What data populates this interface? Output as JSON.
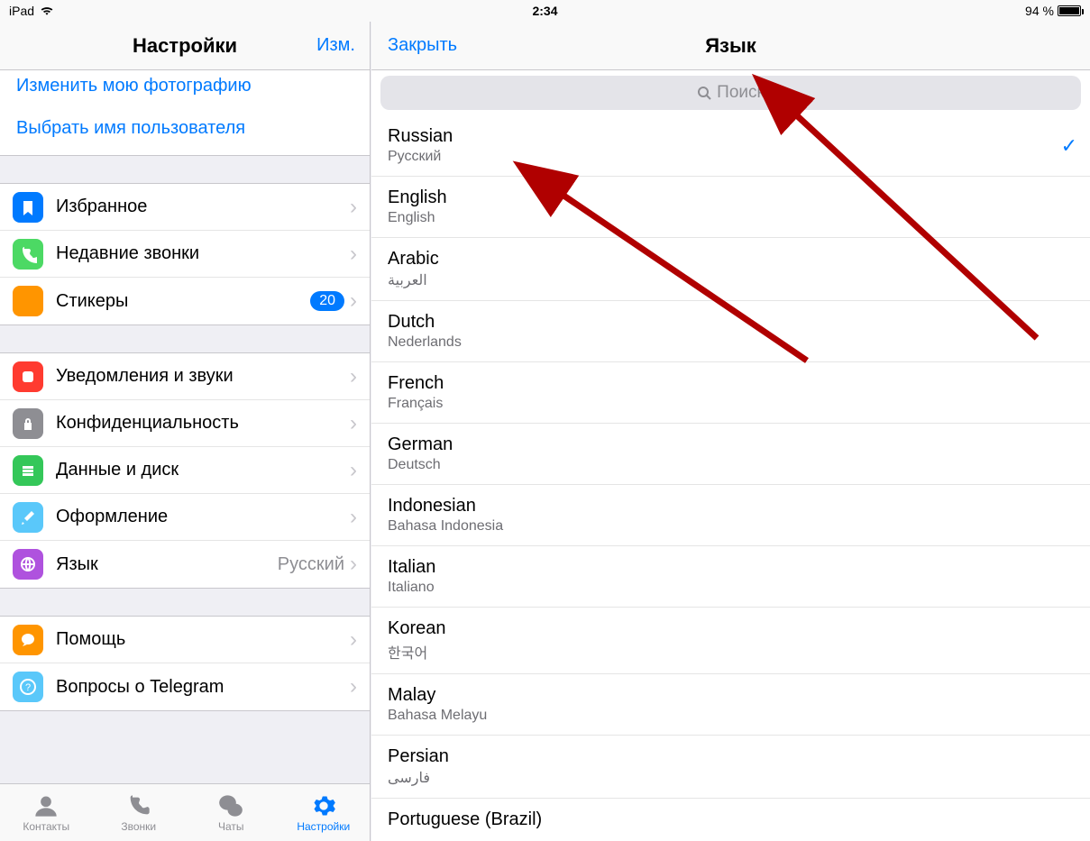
{
  "status": {
    "device": "iPad",
    "time": "2:34",
    "battery_text": "94 %"
  },
  "left": {
    "title": "Настройки",
    "edit": "Изм.",
    "profile_links": {
      "change_photo": "Изменить мою фотографию",
      "choose_username": "Выбрать имя пользователя"
    },
    "group1": [
      {
        "id": "saved",
        "label": "Избранное",
        "icon": "bookmark",
        "bg": "bg-blue"
      },
      {
        "id": "recent",
        "label": "Недавние звонки",
        "icon": "phone",
        "bg": "bg-green"
      },
      {
        "id": "stickers",
        "label": "Стикеры",
        "icon": "moon",
        "bg": "bg-orange",
        "badge": "20"
      }
    ],
    "group2": [
      {
        "id": "notif",
        "label": "Уведомления и звуки",
        "icon": "app",
        "bg": "bg-red"
      },
      {
        "id": "privacy",
        "label": "Конфиденциальность",
        "icon": "lock",
        "bg": "bg-gray"
      },
      {
        "id": "data",
        "label": "Данные и диск",
        "icon": "stack",
        "bg": "bg-teal"
      },
      {
        "id": "appearance",
        "label": "Оформление",
        "icon": "brush",
        "bg": "bg-skyblue"
      },
      {
        "id": "language",
        "label": "Язык",
        "icon": "globe",
        "bg": "bg-purple",
        "detail": "Русский"
      }
    ],
    "group3": [
      {
        "id": "help",
        "label": "Помощь",
        "icon": "chat",
        "bg": "bg-orange"
      },
      {
        "id": "faq",
        "label": "Вопросы о Telegram",
        "icon": "question",
        "bg": "bg-skyblue"
      }
    ]
  },
  "tabs": {
    "contacts": "Контакты",
    "calls": "Звонки",
    "chats": "Чаты",
    "settings": "Настройки"
  },
  "right": {
    "close": "Закрыть",
    "title": "Язык",
    "search_placeholder": "Поиск",
    "selected": "Russian",
    "languages": [
      {
        "name": "Russian",
        "native": "Русский"
      },
      {
        "name": "English",
        "native": "English"
      },
      {
        "name": "Arabic",
        "native": "العربية"
      },
      {
        "name": "Dutch",
        "native": "Nederlands"
      },
      {
        "name": "French",
        "native": "Français"
      },
      {
        "name": "German",
        "native": "Deutsch"
      },
      {
        "name": "Indonesian",
        "native": "Bahasa Indonesia"
      },
      {
        "name": "Italian",
        "native": "Italiano"
      },
      {
        "name": "Korean",
        "native": "한국어"
      },
      {
        "name": "Malay",
        "native": "Bahasa Melayu"
      },
      {
        "name": "Persian",
        "native": "فارسی"
      },
      {
        "name": "Portuguese (Brazil)",
        "native": ""
      }
    ]
  }
}
